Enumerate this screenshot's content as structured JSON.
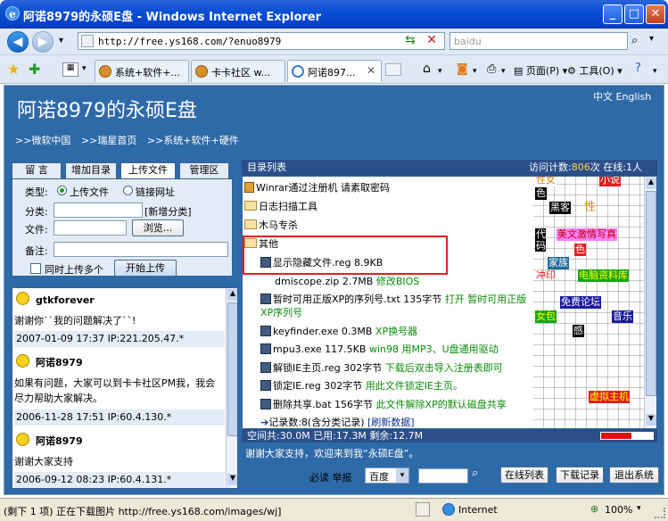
{
  "window": {
    "title": "阿诺8979的永硕E盘 - Windows Internet Explorer",
    "logo_letter": "e"
  },
  "nav": {
    "back": "◀",
    "forward": "▶",
    "dropdown": "▾"
  },
  "address": {
    "url": "http://free.ys168.com/?enuo8979",
    "go_icon": "refresh-icon",
    "stop_icon": "stop-icon"
  },
  "search": {
    "placeholder": "baidu",
    "icon": "search-icon"
  },
  "tabs": [
    {
      "label": "系统+软件+..."
    },
    {
      "label": "卡卡社区 w..."
    },
    {
      "label": "阿诺897..."
    }
  ],
  "toolbar": {
    "page": "页面(P)",
    "tools": "工具(O)"
  },
  "site": {
    "title": "阿诺8979的永硕E盘",
    "lang": "中文 English",
    "links": [
      ">>微软中国",
      ">>瑞星首页",
      ">>系统+软件+硬件"
    ]
  },
  "left_tabs": [
    "留 言",
    "增加目录",
    "上传文件",
    "管理区"
  ],
  "upload": {
    "type_label": "类型:",
    "type_upload": "上传文件",
    "type_link": "链接网址",
    "category_label": "分类:",
    "new_category": "[新增分类]",
    "file_label": "文件:",
    "browse": "浏览...",
    "note_label": "备注:",
    "multi": "同时上传多个",
    "start": "开始上传"
  },
  "messages": [
    {
      "name": "gtkforever",
      "text": "谢谢你``我的问题解决了``!",
      "meta": "2007-01-09 17:37 IP:221.205.47.*"
    },
    {
      "name": "阿诺8979",
      "text": "如果有问题，大家可以到卡卡社区PM我，我会尽力帮助大家解决。",
      "meta": "2006-11-28 17:51 IP:60.4.130.*"
    },
    {
      "name": "阿诺8979",
      "text": "谢谢大家支持",
      "meta": "2006-09-12 08:23 IP:60.4.131.*"
    }
  ],
  "filelist": {
    "title": "目录列表",
    "visits_label": "访问计数:",
    "visits": "806",
    "visits_unit": "次",
    "online_label": "在线:",
    "online": "1",
    "online_unit": "人",
    "items": [
      {
        "kind": "lock",
        "name": "Winrar通过注册机 请素取密码",
        "extra": ""
      },
      {
        "kind": "folder",
        "name": "日志扫描工具",
        "extra": ""
      },
      {
        "kind": "folder",
        "name": "木马专杀",
        "extra": ""
      },
      {
        "kind": "folder",
        "name": "其他",
        "extra": ""
      },
      {
        "kind": "file",
        "name": "显示隐藏文件.reg 8.9KB",
        "extra": ""
      },
      {
        "kind": "file",
        "name": "dmiscope.zip 2.7MB",
        "extra": "修改BIOS"
      },
      {
        "kind": "file",
        "name": "暂时可用正版XP的序列号.txt 135字节",
        "extra": "打开  暂时可用正版XP序列号"
      },
      {
        "kind": "file",
        "name": "keyfinder.exe 0.3MB",
        "extra": "XP换号器"
      },
      {
        "kind": "file",
        "name": "mpu3.exe 117.5KB",
        "extra": "win98 用MP3、U盘通用驱动"
      },
      {
        "kind": "file",
        "name": "解锁IE主页.reg 302字节",
        "extra": "下载后双击导入注册表即可"
      },
      {
        "kind": "file",
        "name": "锁定IE.reg 302字节",
        "extra": "用此文件锁定IE主页。"
      },
      {
        "kind": "file",
        "name": "删除共享.bat 156字节",
        "extra": "此文件解除XP的默认磁盘共享"
      },
      {
        "kind": "summary",
        "name": "记录数:8(含分类记录)",
        "extra": "[刷新数据]"
      }
    ],
    "ads": [
      "性女",
      "小说",
      "色",
      "黑客",
      "性",
      "美文激情写真",
      "代码",
      "色",
      "家族",
      "冲印",
      "电脑资料库",
      "免费论坛",
      "女包",
      "音乐",
      "感",
      "虚拟主机"
    ],
    "space_total": "空间共:30.0M",
    "space_used": "已用:17.3M",
    "space_left": "剩余:12.7M",
    "used_fraction": 0.58
  },
  "welcome": "谢谢大家支持，欢迎来到我“永硕E盘”。",
  "bottom": {
    "recommend": "必读 举报",
    "engine": "百度",
    "online_list": "在线列表",
    "download_log": "下载记录",
    "logout": "退出系统"
  },
  "status": {
    "text": "(剩下 1 项) 正在下载图片 http://free.ys168.com/images/wj]",
    "zone": "Internet",
    "zoom": "100%"
  }
}
